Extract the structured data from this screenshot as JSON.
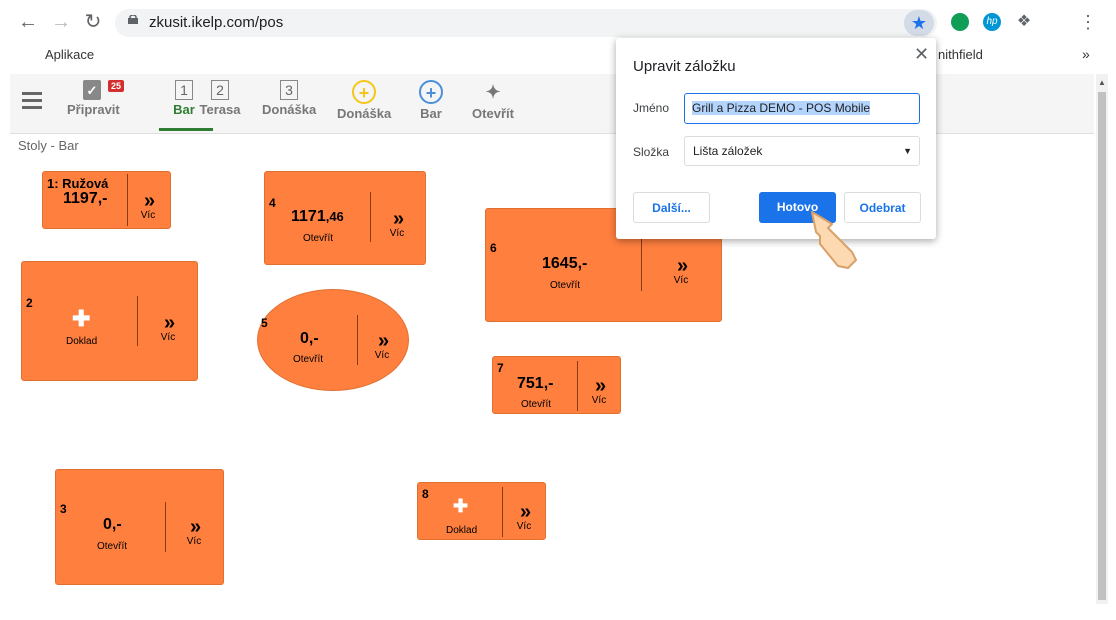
{
  "browser": {
    "url": "zkusit.ikelp.com/pos",
    "bookmarks": {
      "apps_label": "Aplikace",
      "partial_item": "nithfield",
      "overflow": "»"
    }
  },
  "toolbar": {
    "items": [
      {
        "label": "Připravit",
        "badge": "25"
      },
      {
        "label": "Bar",
        "number": "1"
      },
      {
        "label": "Terasa",
        "number": "2"
      },
      {
        "label": "Donáška",
        "number": "3"
      },
      {
        "label": "Donáška"
      },
      {
        "label": "Bar"
      },
      {
        "label": "Otevřít"
      }
    ]
  },
  "breadcrumb": "Stoly - Bar",
  "tables": [
    {
      "number": "1: Ružová",
      "amount": "1197,-",
      "more": "Víc"
    },
    {
      "number": "2",
      "action": "Doklad",
      "more": "Víc"
    },
    {
      "number": "3",
      "amount": "0,-",
      "action": "Otevřít",
      "more": "Víc"
    },
    {
      "number": "4",
      "amount": "1171",
      "amount_cents": ",46",
      "action": "Otevřít",
      "more": "Víc"
    },
    {
      "number": "5",
      "amount": "0,-",
      "action": "Otevřít",
      "more": "Víc"
    },
    {
      "number": "6",
      "amount": "1645,-",
      "action": "Otevřít",
      "more": "Víc"
    },
    {
      "number": "7",
      "amount": "751,-",
      "action": "Otevřít",
      "more": "Víc"
    },
    {
      "number": "8",
      "action": "Doklad",
      "more": "Víc"
    }
  ],
  "bookmark_popup": {
    "title": "Upravit záložku",
    "name_label": "Jméno",
    "name_value": "Grill a Pizza DEMO - POS Mobile",
    "folder_label": "Složka",
    "folder_value": "Lišta záložek",
    "more_button": "Další...",
    "done_button": "Hotovo",
    "remove_button": "Odebrat"
  },
  "colors": {
    "table": "#ff7f3f",
    "accent": "#1a73e8",
    "active_tab": "#2e7d32"
  }
}
